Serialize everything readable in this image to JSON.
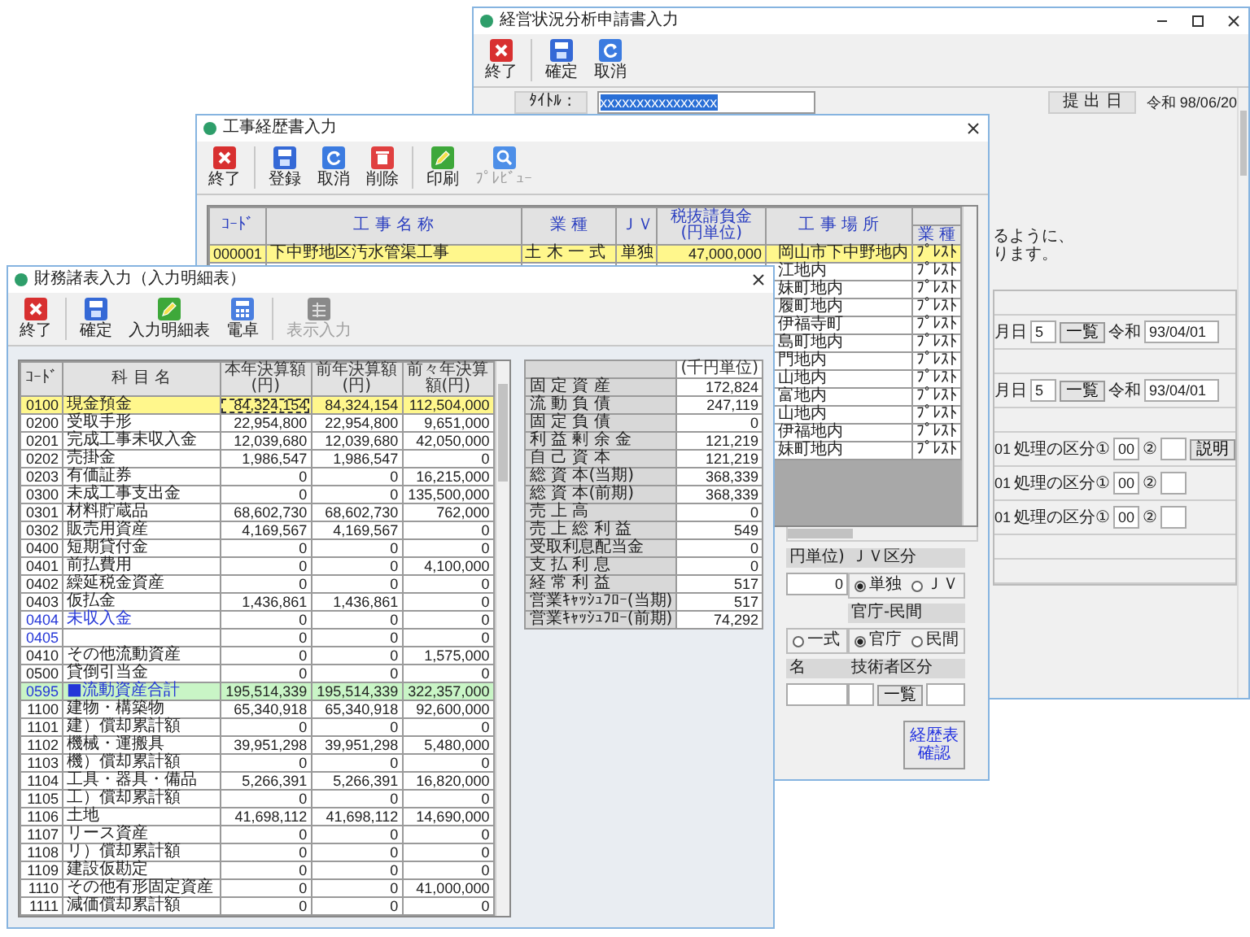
{
  "back_window": {
    "title": "経営状況分析申請書入力",
    "toolbar": [
      {
        "label": "終了",
        "kind": "exit"
      },
      {
        "label": "確定",
        "kind": "confirm"
      },
      {
        "label": "取消",
        "kind": "cancel"
      }
    ],
    "title_label": "ﾀｲﾄﾙ :",
    "title_value": "xxxxxxxxxxxxxxxx",
    "date_label": "提 出 日",
    "date_value": "令和 98/06/20",
    "notes": [
      "るように、",
      "ります。"
    ],
    "date_rows": [
      {
        "label": "月日",
        "number": "5",
        "button": "一覧",
        "era": "令和",
        "date": "93/04/01"
      },
      {
        "label": "月日",
        "number": "5",
        "button": "一覧",
        "era": "令和",
        "date": "93/04/01"
      }
    ],
    "process_rows": [
      {
        "number": "01",
        "label": "処理の区分①",
        "code": "00",
        "label_2": "②",
        "button": "説明"
      },
      {
        "number": "01",
        "label": "処理の区分①",
        "code": "00",
        "label_2": "②"
      },
      {
        "number": "01",
        "label": "処理の区分①",
        "code": "00",
        "label_2": "②"
      }
    ]
  },
  "middle_window": {
    "title": "工事経歴書入力",
    "toolbar": [
      {
        "label": "終了",
        "kind": "exit",
        "disabled": false
      },
      {
        "label": "登録",
        "kind": "confirm",
        "disabled": false
      },
      {
        "label": "取消",
        "kind": "cancel",
        "disabled": false
      },
      {
        "label": "削除",
        "kind": "delete",
        "disabled": false
      },
      {
        "label": "印刷",
        "kind": "print",
        "disabled": false
      },
      {
        "label": "ﾌﾟﾚﾋﾞｭｰ",
        "kind": "preview",
        "disabled": true
      }
    ],
    "columns": [
      "ｺｰﾄﾞ",
      "工 事 名 称",
      "業 種",
      "ＪＶ",
      "税抜請負金(円単位)",
      "工 事 場 所",
      "業 種"
    ],
    "rows": [
      {
        "code": "000001",
        "name": "下中野地区汚水管渠工事",
        "type": "土 木 一 式",
        "jv": "単独",
        "amount": "47,000,000",
        "place": "岡山市下中野地内",
        "type_code": "ﾌﾟﾚｽﾄ",
        "selected": true
      },
      {
        "place": "江地内",
        "type_code": "ﾌﾟﾚｽﾄ",
        "selected": false
      },
      {
        "place": "妹町地内",
        "type_code": "ﾌﾟﾚｽﾄ",
        "selected": false
      },
      {
        "place": "履町地内",
        "type_code": "ﾌﾟﾚｽﾄ",
        "selected": false
      },
      {
        "place": "伊福寺町",
        "type_code": "ﾌﾟﾚｽﾄ",
        "selected": false
      },
      {
        "place": "島町地内",
        "type_code": "ﾌﾟﾚｽﾄ",
        "selected": false
      },
      {
        "place": "門地内",
        "type_code": "ﾌﾟﾚｽﾄ",
        "selected": false
      },
      {
        "place": "山地内",
        "type_code": "ﾌﾟﾚｽﾄ",
        "selected": false
      },
      {
        "place": "富地内",
        "type_code": "ﾌﾟﾚｽﾄ",
        "selected": false
      },
      {
        "place": "山地内",
        "type_code": "ﾌﾟﾚｽﾄ",
        "selected": false
      },
      {
        "place": "伊福地内",
        "type_code": "ﾌﾟﾚｽﾄ",
        "selected": false
      },
      {
        "place": "妹町地内",
        "type_code": "ﾌﾟﾚｽﾄ",
        "selected": false
      }
    ],
    "form": {
      "amount_label": "円単位)",
      "jv_label": "ＪＶ区分",
      "amount_value": "0",
      "jv_options": [
        {
          "label": "単独",
          "selected": true
        },
        {
          "label": "ＪＶ",
          "selected": false
        }
      ],
      "sector_label": "官庁-民間",
      "scope_options": [
        {
          "label": "一式",
          "selected": false
        }
      ],
      "sector_options": [
        {
          "label": "官庁",
          "selected": true
        },
        {
          "label": "民間",
          "selected": false
        }
      ],
      "name_label": "名",
      "engineer_label": "技術者区分",
      "list_button": "一覧",
      "confirm_button": "経歴表確認"
    }
  },
  "front_window": {
    "title": "財務諸表入力（入力明細表）",
    "toolbar": [
      {
        "label": "終了",
        "kind": "exit",
        "disabled": false
      },
      {
        "label": "確定",
        "kind": "confirm",
        "disabled": false
      },
      {
        "label": "入力明細表",
        "kind": "ledger",
        "disabled": false
      },
      {
        "label": "電卓",
        "kind": "calc",
        "disabled": false
      },
      {
        "label": "表示入力",
        "kind": "display",
        "disabled": true
      }
    ],
    "columns": [
      "ｺｰﾄﾞ",
      "科 目 名",
      "本年決算額(円)",
      "前年決算額(円)",
      "前々年決算額(円)"
    ],
    "rows": [
      {
        "code": "0100",
        "name": "現金預金",
        "current": "84,324,154",
        "previous": "84,324,154",
        "before_previous": "112,504,000",
        "kind": "item",
        "selected": true
      },
      {
        "code": "0200",
        "name": "受取手形",
        "current": "22,954,800",
        "previous": "22,954,800",
        "before_previous": "9,651,000",
        "kind": "item",
        "selected": false
      },
      {
        "code": "0201",
        "name": "完成工事未収入金",
        "current": "12,039,680",
        "previous": "12,039,680",
        "before_previous": "42,050,000",
        "kind": "item",
        "selected": false
      },
      {
        "code": "0202",
        "name": "売掛金",
        "current": "1,986,547",
        "previous": "1,986,547",
        "before_previous": "0",
        "kind": "item",
        "selected": false
      },
      {
        "code": "0203",
        "name": "有価証券",
        "current": "0",
        "previous": "0",
        "before_previous": "16,215,000",
        "kind": "item",
        "selected": false
      },
      {
        "code": "0300",
        "name": "未成工事支出金",
        "current": "0",
        "previous": "0",
        "before_previous": "135,500,000",
        "kind": "item",
        "selected": false
      },
      {
        "code": "0301",
        "name": "材料貯蔵品",
        "current": "68,602,730",
        "previous": "68,602,730",
        "before_previous": "762,000",
        "kind": "item",
        "selected": false
      },
      {
        "code": "0302",
        "name": "販売用資産",
        "current": "4,169,567",
        "previous": "4,169,567",
        "before_previous": "0",
        "kind": "item",
        "selected": false
      },
      {
        "code": "0400",
        "name": "短期貸付金",
        "current": "0",
        "previous": "0",
        "before_previous": "0",
        "kind": "item",
        "selected": false
      },
      {
        "code": "0401",
        "name": "前払費用",
        "current": "0",
        "previous": "0",
        "before_previous": "4,100,000",
        "kind": "item",
        "selected": false
      },
      {
        "code": "0402",
        "name": "繰延税金資産",
        "current": "0",
        "previous": "0",
        "before_previous": "0",
        "kind": "item",
        "selected": false
      },
      {
        "code": "0403",
        "name": "仮払金",
        "current": "1,436,861",
        "previous": "1,436,861",
        "before_previous": "0",
        "kind": "item",
        "selected": false
      },
      {
        "code": "0404",
        "name": "未収入金",
        "current": "0",
        "previous": "0",
        "before_previous": "0",
        "kind": "entry",
        "selected": false
      },
      {
        "code": "0405",
        "current": "0",
        "previous": "0",
        "before_previous": "0",
        "kind": "entry",
        "selected": false
      },
      {
        "code": "0410",
        "name": "その他流動資産",
        "current": "0",
        "previous": "0",
        "before_previous": "1,575,000",
        "kind": "item",
        "selected": false
      },
      {
        "code": "0500",
        "name": "貸倒引当金",
        "current": "0",
        "previous": "0",
        "before_previous": "0",
        "kind": "item",
        "selected": false
      },
      {
        "code": "0595",
        "name": "■流動資産合計",
        "current": "195,514,339",
        "previous": "195,514,339",
        "before_previous": "322,357,000",
        "kind": "total",
        "selected": false
      },
      {
        "code": "1100",
        "name": "建物・構築物",
        "current": "65,340,918",
        "previous": "65,340,918",
        "before_previous": "92,600,000",
        "kind": "item",
        "selected": false
      },
      {
        "code": "1101",
        "name": "建）償却累計額",
        "current": "0",
        "previous": "0",
        "before_previous": "0",
        "kind": "item",
        "selected": false
      },
      {
        "code": "1102",
        "name": "機械・運搬具",
        "current": "39,951,298",
        "previous": "39,951,298",
        "before_previous": "5,480,000",
        "kind": "item",
        "selected": false
      },
      {
        "code": "1103",
        "name": "機）償却累計額",
        "current": "0",
        "previous": "0",
        "before_previous": "0",
        "kind": "item",
        "selected": false
      },
      {
        "code": "1104",
        "name": "工具・器具・備品",
        "current": "5,266,391",
        "previous": "5,266,391",
        "before_previous": "16,820,000",
        "kind": "item",
        "selected": false
      },
      {
        "code": "1105",
        "name": "工）償却累計額",
        "current": "0",
        "previous": "0",
        "before_previous": "0",
        "kind": "item",
        "selected": false
      },
      {
        "code": "1106",
        "name": "土地",
        "current": "41,698,112",
        "previous": "41,698,112",
        "before_previous": "14,690,000",
        "kind": "item",
        "selected": false
      },
      {
        "code": "1107",
        "name": "リース資産",
        "current": "0",
        "previous": "0",
        "before_previous": "0",
        "kind": "item",
        "selected": false
      },
      {
        "code": "1108",
        "name": "リ）償却累計額",
        "current": "0",
        "previous": "0",
        "before_previous": "0",
        "kind": "item",
        "selected": false
      },
      {
        "code": "1109",
        "name": "建設仮勘定",
        "current": "0",
        "previous": "0",
        "before_previous": "0",
        "kind": "item",
        "selected": false
      },
      {
        "code": "1110",
        "name": "その他有形固定資産",
        "current": "0",
        "previous": "0",
        "before_previous": "41,000,000",
        "kind": "item",
        "selected": false
      },
      {
        "code": "1111",
        "name": "減価償却累計額",
        "current": "0",
        "previous": "0",
        "before_previous": "0",
        "kind": "item",
        "selected": false
      }
    ],
    "summary": {
      "unit": "(千円単位)",
      "rows": [
        {
          "label": "固 定 資 産",
          "value": "172,824"
        },
        {
          "label": "流 動 負 債",
          "value": "247,119"
        },
        {
          "label": "固 定 負 債",
          "value": "0"
        },
        {
          "label": "利 益 剰 余 金",
          "value": "121,219"
        },
        {
          "label": "自 己 資 本",
          "value": "121,219"
        },
        {
          "label": "総 資 本(当期)",
          "value": "368,339"
        },
        {
          "label": "総 資 本(前期)",
          "value": "368,339"
        },
        {
          "label": "売 上 高",
          "value": "0"
        },
        {
          "label": "売 上 総 利 益",
          "value": "549"
        },
        {
          "label": "受取利息配当金",
          "value": "0"
        },
        {
          "label": "支 払 利 息",
          "value": "0"
        },
        {
          "label": "経 常 利 益",
          "value": "517"
        },
        {
          "label": "営業ｷｬｯｼｭﾌﾛｰ(当期)",
          "value": "517"
        },
        {
          "label": "営業ｷｬｯｼｭﾌﾛｰ(前期)",
          "value": "74,292"
        }
      ]
    }
  }
}
